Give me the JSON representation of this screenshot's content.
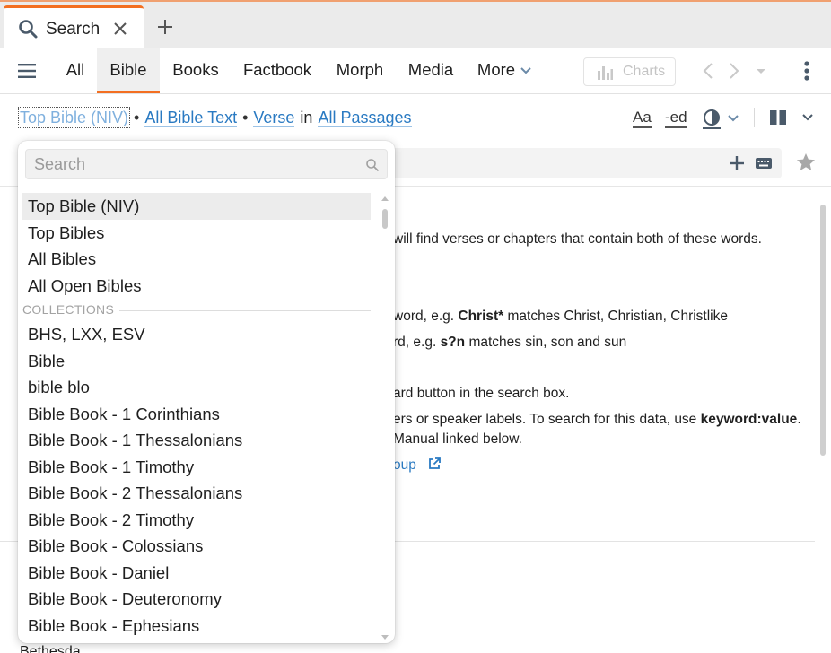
{
  "tab": {
    "title": "Search"
  },
  "toolbar": {
    "tabs": [
      "All",
      "Bible",
      "Books",
      "Factbook",
      "Morph",
      "Media",
      "More"
    ],
    "active_tab": "Bible",
    "charts_label": "Charts"
  },
  "scope": {
    "resource": "Top Bible (NIV)",
    "text": "All Bible Text",
    "unit": "Verse",
    "in_word": "in",
    "range": "All Passages"
  },
  "tools": {
    "font_label": "Aa",
    "ed_label": "-ed"
  },
  "help": {
    "line1": "will find verses or chapters that contain both of these words.",
    "line2_prefix": "word, e.g.",
    "line2_bold": "Christ*",
    "line2_suffix": "matches Christ, Christian, Christlike",
    "line3_prefix": "rd, e.g.",
    "line3_bold": "s?n",
    "line3_suffix": "matches sin, son and sun",
    "line4": "ard button in the search box.",
    "line5_prefix": "ers or speaker labels. To search for this data, use",
    "line5_bold": "keyword:value",
    "line5_suffix": ".",
    "line6": "Manual linked below.",
    "link_fragment": "oup"
  },
  "bottom_fragment": "Bethesda",
  "dropdown": {
    "placeholder": "Search",
    "top_items": [
      "Top Bible (NIV)",
      "Top Bibles",
      "All Bibles",
      "All Open Bibles"
    ],
    "selected": "Top Bible (NIV)",
    "section_label": "COLLECTIONS",
    "collection_items": [
      "BHS, LXX, ESV",
      "Bible",
      "bible blo",
      "Bible Book - 1 Corinthians",
      "Bible Book - 1 Thessalonians",
      "Bible Book - 1 Timothy",
      "Bible Book - 2 Thessalonians",
      "Bible Book - 2 Timothy",
      "Bible Book - Colossians",
      "Bible Book - Daniel",
      "Bible Book - Deuteronomy",
      "Bible Book - Ephesians"
    ]
  },
  "colors": {
    "accent": "#f36f21",
    "link": "#2a7ac2",
    "selected_bg": "#ececec"
  }
}
